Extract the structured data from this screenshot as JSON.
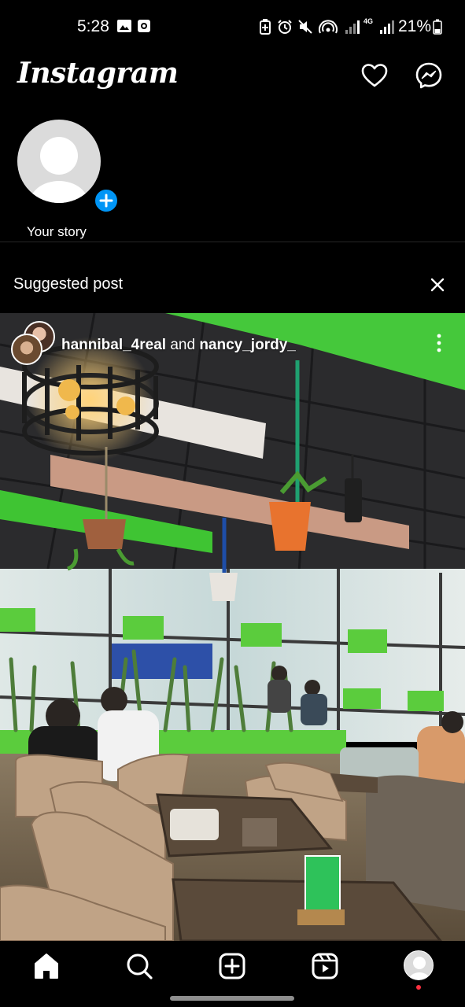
{
  "status_bar": {
    "time": "5:28",
    "network": "4G",
    "battery": "21%",
    "icons": [
      "image-icon",
      "screen-record-icon",
      "battery-saver-icon",
      "alarm-icon",
      "mute-icon",
      "hotspot-icon",
      "signal-icon",
      "signal-icon",
      "battery-icon"
    ]
  },
  "header": {
    "logo": "Instagram",
    "icons": [
      "heart-icon",
      "messenger-icon"
    ]
  },
  "stories": [
    {
      "label": "Your story"
    }
  ],
  "suggested": {
    "title": "Suggested post"
  },
  "post": {
    "user1": "hannibal_4real",
    "connector": "and",
    "user2": "nancy_jordy_"
  },
  "nav": {
    "items": [
      "home-icon",
      "search-icon",
      "create-icon",
      "reels-icon",
      "profile-avatar"
    ]
  },
  "colors": {
    "background": "#000000",
    "accent_blue": "#0095f6",
    "notification_red": "#ff3040",
    "restaurant_green": "#3ecb3a"
  }
}
